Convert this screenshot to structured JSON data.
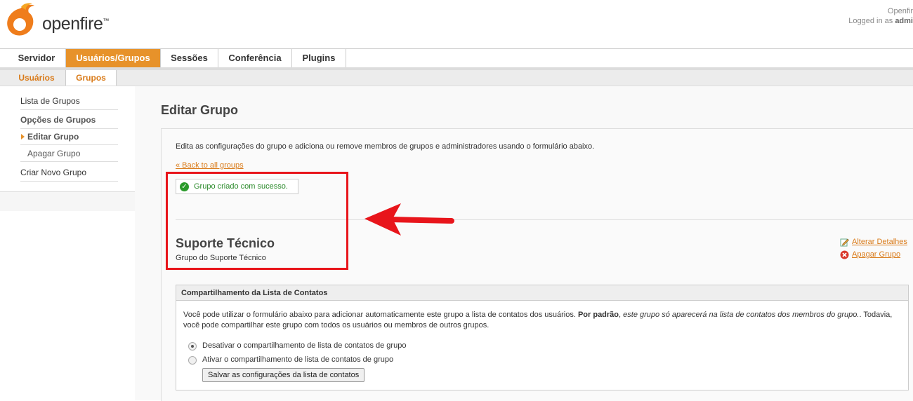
{
  "header": {
    "brand": "openfire",
    "trademark": "™",
    "right_line1": "Openfir",
    "logged_in_prefix": "Logged in as ",
    "logged_in_user": "admi"
  },
  "main_tabs": [
    {
      "label": "Servidor",
      "active": false
    },
    {
      "label": "Usuários/Grupos",
      "active": true
    },
    {
      "label": "Sessões",
      "active": false
    },
    {
      "label": "Conferência",
      "active": false
    },
    {
      "label": "Plugins",
      "active": false
    }
  ],
  "sub_tabs": [
    {
      "label": "Usuários",
      "active": false
    },
    {
      "label": "Grupos",
      "active": true
    }
  ],
  "sidebar": {
    "items": [
      {
        "label": "Lista de Grupos"
      },
      {
        "label": "Opções de Grupos"
      },
      {
        "label": "Editar Grupo"
      },
      {
        "label": "Apagar Grupo"
      },
      {
        "label": "Criar Novo Grupo"
      }
    ]
  },
  "page": {
    "title": "Editar Grupo",
    "intro": "Edita as configurações do grupo e adiciona ou remove membros de grupos e administradores usando o formulário abaixo.",
    "back_link": "« Back to all groups",
    "success_message": "Grupo criado com sucesso.",
    "group_name": "Suporte Técnico",
    "group_description": "Grupo do Suporte Técnico",
    "actions": {
      "edit": "Alterar Detalhes",
      "delete": "Apagar Grupo"
    }
  },
  "sharing": {
    "heading": "Compartilhamento da Lista de Contatos",
    "text_a": "Você pode utilizar o formulário abaixo para adicionar automaticamente este grupo a lista de contatos dos usuários. ",
    "text_bold": "Por padrão",
    "text_b": ", ",
    "text_italic": "este grupo só aparecerá na lista de contatos dos membros do grupo.",
    "text_c": ". Todavia, você pode compartilhar este grupo com todos os usuários ou membros de outros grupos.",
    "option_disable": "Desativar o compartilhamento de lista de contatos de grupo",
    "option_enable": "Ativar o compartilhamento de lista de contatos de grupo",
    "selected": "disable",
    "save_label": "Salvar as configurações da lista de contatos"
  },
  "colors": {
    "accent": "#e7922a",
    "link": "#d97a18",
    "annotation_red": "#e8151b",
    "success_green": "#2a8a2a"
  },
  "icons": [
    "openfire-logo-icon",
    "check-circle-icon",
    "edit-icon",
    "delete-icon",
    "red-arrow-icon"
  ]
}
